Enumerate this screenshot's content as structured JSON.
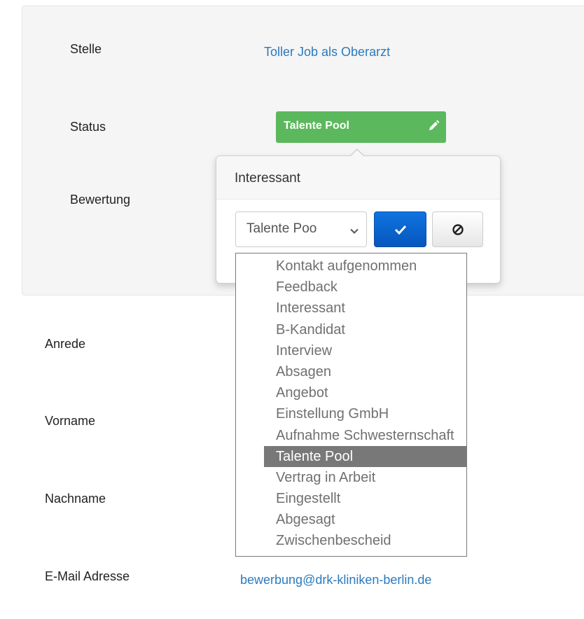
{
  "panel": {
    "stelle_label": "Stelle",
    "stelle_value": "Toller Job als Oberarzt",
    "status_label": "Status",
    "status_badge": "Talente Pool",
    "bewertung_label": "Bewertung"
  },
  "popover": {
    "title": "Interessant",
    "select_value": "Talente Poo",
    "ok_icon": "checkmark-icon",
    "cancel_icon": "ban-icon"
  },
  "dropdown": {
    "options": [
      "Kontakt aufgenommen",
      "Feedback",
      "Interessant",
      "B-Kandidat",
      "Interview",
      "Absagen",
      "Angebot",
      "Einstellung GmbH",
      "Aufnahme Schwesternschaft",
      "Talente Pool",
      "Vertrag in Arbeit",
      "Eingestellt",
      "Abgesagt",
      "Zwischenbescheid"
    ],
    "selected": "Talente Pool"
  },
  "form": {
    "anrede_label": "Anrede",
    "vorname_label": "Vorname",
    "nachname_label": "Nachname",
    "email_label": "E-Mail Adresse",
    "email_value": "bewerbung@drk-kliniken-berlin.de"
  },
  "colors": {
    "status_green": "#5cb85c",
    "ok_blue": "#0b63ce",
    "link_blue": "#2a7bbf",
    "selected_gray": "#787878"
  }
}
